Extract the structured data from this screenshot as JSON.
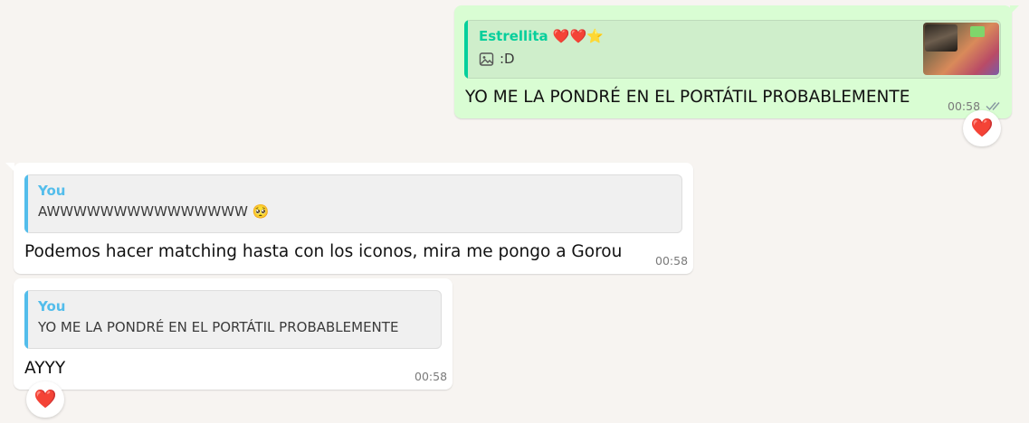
{
  "colors": {
    "chat_bg": "#f7f4f1",
    "outgoing_bubble": "#d9fdd3",
    "incoming_bubble": "#ffffff",
    "quote_bar_contact": "#06cf9c",
    "quote_name_contact": "#06cf9c",
    "quote_bar_you": "#53bdeb",
    "quote_name_you": "#53bdeb"
  },
  "messages": [
    {
      "direction": "outgoing",
      "quote": {
        "author": "Estrellita ❤️❤️⭐",
        "text": ":D",
        "has_image": true,
        "icon": "image-icon"
      },
      "text": "YO ME LA PONDRÉ EN EL PORTÁTIL PROBABLEMENTE",
      "time": "00:58",
      "status_icon": "double-check-icon",
      "reaction": "❤️"
    },
    {
      "direction": "incoming",
      "quote": {
        "author": "You",
        "text": "AWWWWWWWWWWWWWWW 🥺"
      },
      "text": "Podemos hacer matching hasta con los iconos, mira me pongo a Gorou",
      "time": "00:58"
    },
    {
      "direction": "incoming",
      "quote": {
        "author": "You",
        "text": "YO ME LA PONDRÉ EN EL PORTÁTIL PROBABLEMENTE"
      },
      "text": "AYYY",
      "time": "00:58",
      "reaction": "❤️"
    }
  ]
}
